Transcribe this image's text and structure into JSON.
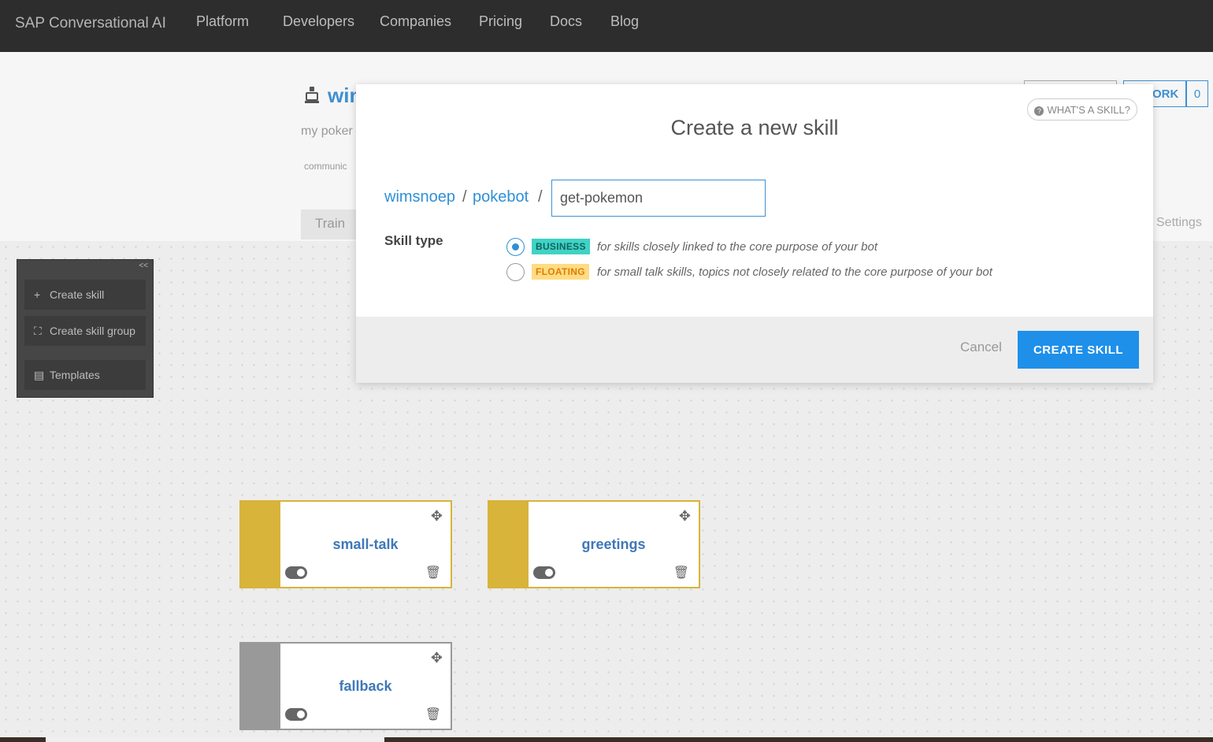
{
  "nav": {
    "brand": "SAP Conversational AI",
    "items": [
      "Platform",
      "Developers",
      "Companies",
      "Pricing",
      "Docs",
      "Blog"
    ]
  },
  "background": {
    "bot_name": "win",
    "bot_description": "my poker",
    "bot_tag": "communic",
    "tab_train": "Train",
    "tab_settings": "Settings",
    "fork_label": "ORK",
    "fork_count": "0",
    "toolbox": {
      "collapse": "<<",
      "create_skill": "Create skill",
      "create_skill_group": "Create skill group",
      "templates": "Templates"
    },
    "skills": [
      {
        "name": "small-talk",
        "color": "#d8b43a"
      },
      {
        "name": "greetings",
        "color": "#d8b43a"
      },
      {
        "name": "fallback",
        "color": "#999999"
      }
    ]
  },
  "modal": {
    "whats_a_skill": "WHAT'S A SKILL?",
    "title": "Create a new skill",
    "user": "wimsnoep",
    "separator": "/",
    "bot": "pokebot",
    "skill_name_value": "get-pokemon",
    "skill_type_label": "Skill type",
    "options": [
      {
        "badge": "BUSINESS",
        "description": "for skills closely linked to the core purpose of your bot",
        "selected": true
      },
      {
        "badge": "FLOATING",
        "description": "for small talk skills, topics not closely related to the core purpose of your bot",
        "selected": false
      }
    ],
    "cancel_label": "Cancel",
    "create_label": "CREATE SKILL"
  },
  "colors": {
    "accent": "#1e90ea",
    "business": "#3ed3c5",
    "floating": "#ffdc84"
  }
}
